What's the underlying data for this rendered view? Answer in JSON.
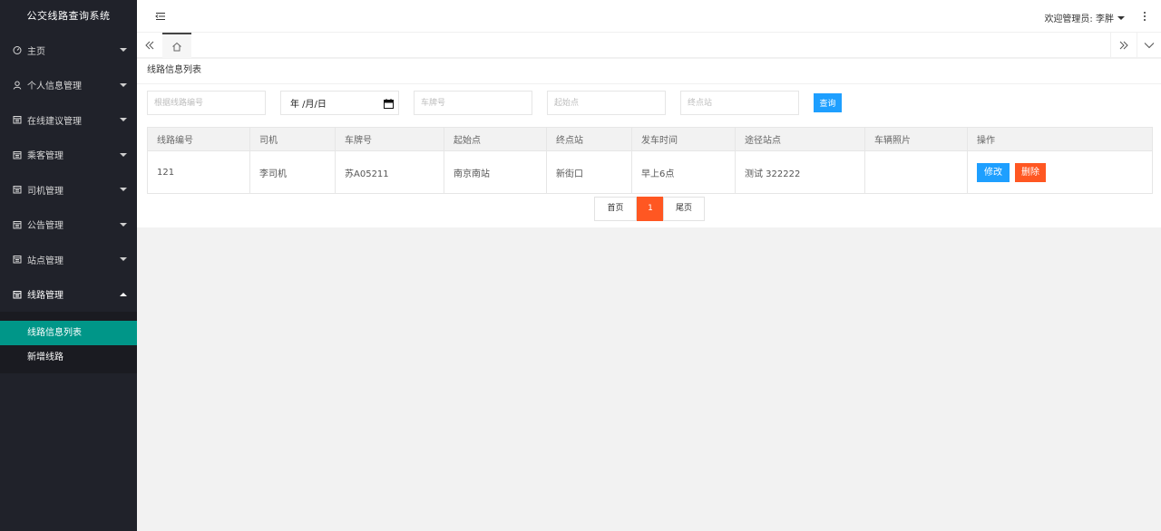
{
  "app": {
    "title": "公交线路查询系统"
  },
  "sidebar": {
    "items": [
      {
        "label": "主页",
        "icon": "gauge-icon"
      },
      {
        "label": "个人信息管理",
        "icon": "user-icon"
      },
      {
        "label": "在线建议管理",
        "icon": "calendar-icon"
      },
      {
        "label": "乘客管理",
        "icon": "calendar-icon"
      },
      {
        "label": "司机管理",
        "icon": "calendar-icon"
      },
      {
        "label": "公告管理",
        "icon": "calendar-icon"
      },
      {
        "label": "站点管理",
        "icon": "calendar-icon"
      },
      {
        "label": "线路管理",
        "icon": "calendar-icon"
      }
    ],
    "submenu": [
      {
        "label": "线路信息列表",
        "active": true
      },
      {
        "label": "新增线路",
        "active": false
      }
    ]
  },
  "header": {
    "user_label": "欢迎管理员: 李胖"
  },
  "page": {
    "title": "线路信息列表",
    "search": {
      "route_no_placeholder": "根据线路编号",
      "date_value": "年 /月/日",
      "plate_placeholder": "车牌号",
      "start_placeholder": "起始点",
      "end_placeholder": "终点站",
      "search_label": "查询"
    },
    "table": {
      "headers": [
        "线路编号",
        "司机",
        "车牌号",
        "起始点",
        "终点站",
        "发车时间",
        "途径站点",
        "车辆照片",
        "操作"
      ],
      "rows": [
        {
          "route_no": "121",
          "driver": "李司机",
          "plate": "苏A05211",
          "start": "南京南站",
          "end": "新街口",
          "depart": "早上6点",
          "stops": "测试 322222",
          "photo": ""
        }
      ],
      "edit_label": "修改",
      "delete_label": "删除"
    },
    "pager": {
      "first": "首页",
      "current": "1",
      "last": "尾页"
    }
  },
  "colors": {
    "sidebar_bg": "#20222a",
    "active_green": "#009688",
    "primary_blue": "#1e9fff",
    "danger_orange": "#ff5722"
  }
}
